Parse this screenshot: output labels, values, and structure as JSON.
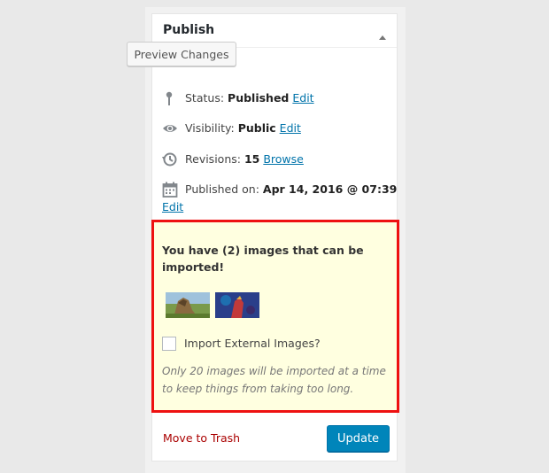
{
  "panel": {
    "title": "Publish",
    "toggle_icon": "triangle-up-icon"
  },
  "preview": {
    "label": "Preview Changes"
  },
  "status": {
    "label": "Status:",
    "value": "Published",
    "link": "Edit",
    "icon": "pin-icon"
  },
  "visibility": {
    "label": "Visibility:",
    "value": "Public",
    "link": "Edit",
    "icon": "eye-icon"
  },
  "revisions": {
    "label": "Revisions:",
    "value": "15",
    "link": "Browse",
    "icon": "history-icon"
  },
  "published": {
    "label": "Published on:",
    "value": "Apr 14, 2016 @ 07:39",
    "link": "Edit",
    "icon": "calendar-icon"
  },
  "import_notice": {
    "message": "You have (2) images that can be imported!",
    "checkbox_label": "Import External Images?",
    "checked": false,
    "note": "Only 20 images will be imported at a time to keep things from taking too long.",
    "highlight_color": "#ee1111"
  },
  "actions": {
    "trash": "Move to Trash",
    "update": "Update"
  },
  "colors": {
    "primary": "#0085ba",
    "link": "#0073aa",
    "danger": "#aa0000",
    "notice_bg": "#ffffe0"
  }
}
